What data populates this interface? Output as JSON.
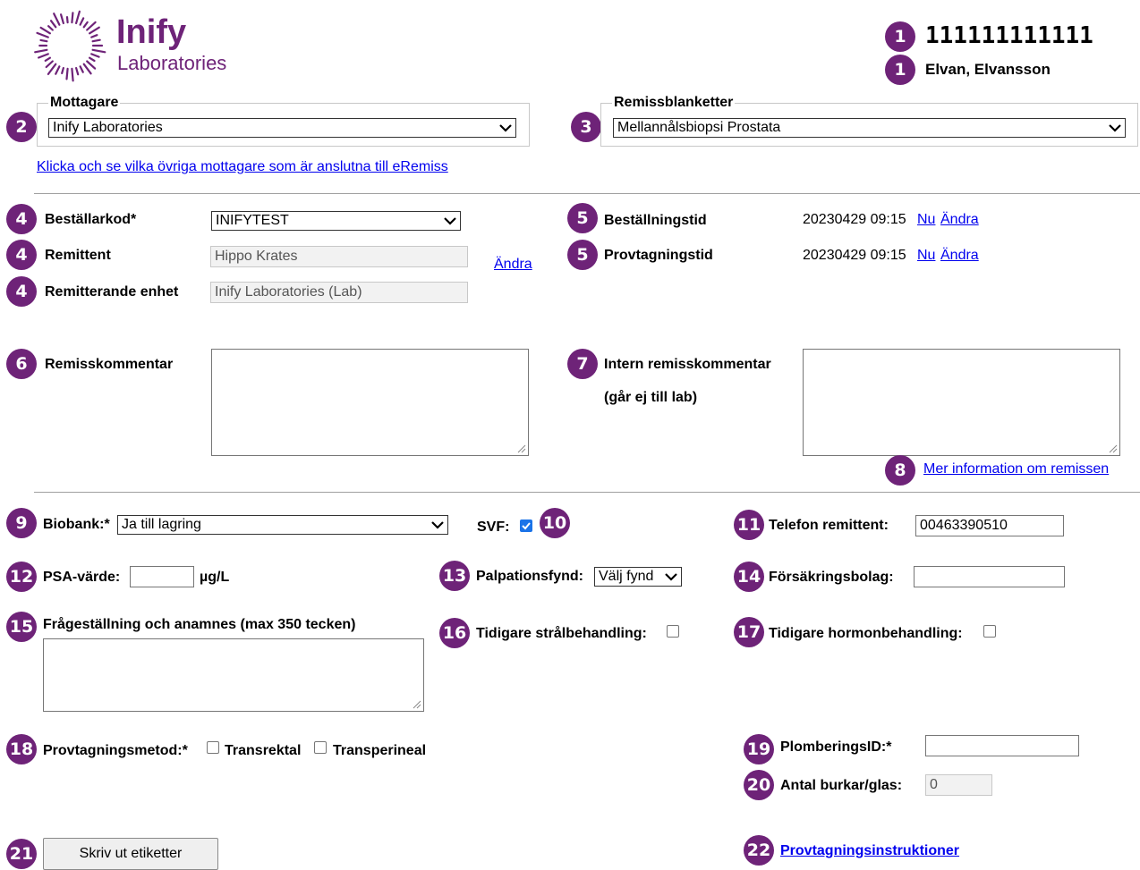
{
  "logo": {
    "title": "Inify",
    "subtitle": "Laboratories"
  },
  "patient": {
    "id": "111111111111",
    "name": "Elvan, Elvansson"
  },
  "badges": {
    "b1": "1",
    "b2": "2",
    "b3": "3",
    "b4": "4",
    "b5": "5",
    "b6": "6",
    "b7": "7",
    "b8": "8",
    "b9": "9",
    "b10": "10",
    "b11": "11",
    "b12": "12",
    "b13": "13",
    "b14": "14",
    "b15": "15",
    "b16": "16",
    "b17": "17",
    "b18": "18",
    "b19": "19",
    "b20": "20",
    "b21": "21",
    "b22": "22"
  },
  "mottagare": {
    "legend": "Mottagare",
    "value": "Inify Laboratories"
  },
  "remissblanketter": {
    "legend": "Remissblanketter",
    "value": "Mellannålsbiopsi Prostata"
  },
  "other_recipients_link": "Klicka och se vilka övriga mottagare som är anslutna till eRemiss",
  "orderer": {
    "bestallarkod_label": "Beställarkod*",
    "bestallarkod_value": "INIFYTEST",
    "remittent_label": "Remittent",
    "remittent_value": "Hippo Krates",
    "enhet_label": "Remitterande enhet",
    "enhet_value": "Inify Laboratories (Lab)",
    "change_link": "Ändra"
  },
  "times": {
    "bestallningstid_label": "Beställningstid",
    "bestallningstid_value": "20230429 09:15",
    "provtagningstid_label": "Provtagningstid",
    "provtagningstid_value": "20230429 09:15",
    "now_link": "Nu",
    "change_link": "Ändra"
  },
  "comments": {
    "remisskommentar_label": "Remisskommentar",
    "intern_label": "Intern remisskommentar",
    "intern_sub": "(går ej till lab)",
    "more_info_link": "Mer information om remissen"
  },
  "details": {
    "biobank_label": "Biobank:*",
    "biobank_value": "Ja till lagring",
    "svf_label": "SVF:",
    "telefon_label": "Telefon remittent:",
    "telefon_value": "00463390510",
    "psa_label": "PSA-värde:",
    "psa_unit": "µg/L",
    "palpation_label": "Palpationsfynd:",
    "palpation_value": "Välj fynd",
    "forsakring_label": "Försäkringsbolag:",
    "fragestallning_label": "Frågeställning och anamnes (max 350 tecken)",
    "stral_label": "Tidigare strålbehandling:",
    "hormon_label": "Tidigare hormonbehandling:",
    "metod_label": "Provtagningsmetod:*",
    "transrektal": "Transrektal",
    "transperineal": "Transperineal",
    "plombering_label": "PlomberingsID:*",
    "antal_label": "Antal burkar/glas:",
    "antal_value": "0"
  },
  "print_button": "Skriv ut etiketter",
  "instructions_link": "Provtagningsinstruktioner",
  "colors": {
    "badge": "#6e2378",
    "link": "#0000ee",
    "checkbox_checked": "#1a73e8"
  }
}
